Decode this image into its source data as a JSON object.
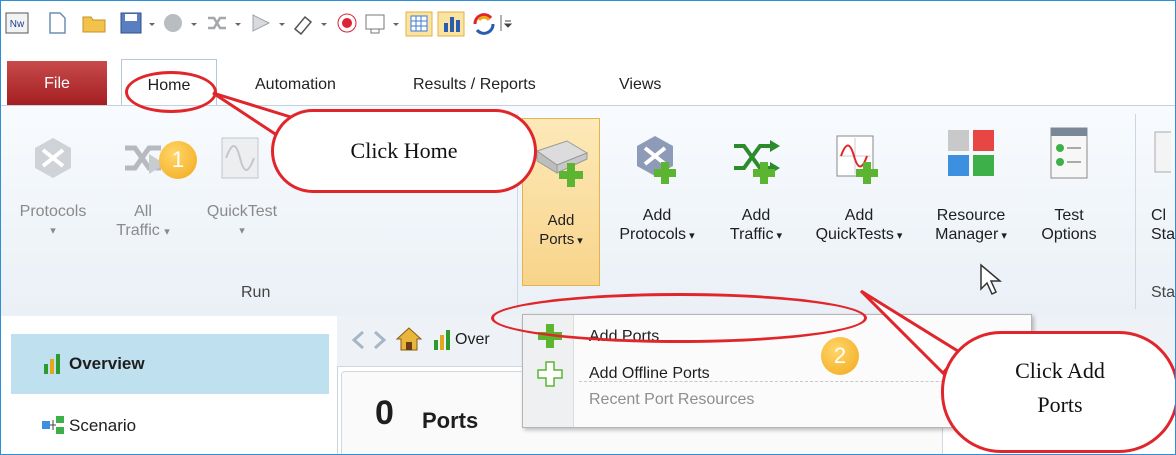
{
  "tabs": {
    "file": "File",
    "home": "Home",
    "automation": "Automation",
    "results": "Results / Reports",
    "views": "Views"
  },
  "qat": {
    "logo": "Nw"
  },
  "ribbon": {
    "run_group": {
      "label": "Run",
      "protocols": "Protocols",
      "all_traffic_line1": "All",
      "all_traffic_line2": "Traffic",
      "quicktest": "QuickTest"
    },
    "add_ports": [
      "Add",
      "Ports"
    ],
    "add_protocols": [
      "Add",
      "Protocols"
    ],
    "add_traffic": [
      "Add",
      "Traffic"
    ],
    "add_quicktests": [
      "Add",
      "QuickTests"
    ],
    "resource_manager": [
      "Resource",
      "Manager"
    ],
    "test_options": [
      "Test",
      "Options"
    ],
    "partial_button": [
      "Cl",
      "Sta"
    ],
    "partial_group": "Sta"
  },
  "dropdown": {
    "add_ports": "Add Ports",
    "add_offline_ports": "Add Offline Ports",
    "recent": "Recent Port Resources"
  },
  "nav": {
    "overview": "Overview",
    "scenario": "Scenario"
  },
  "breadcrumb": {
    "overview": "Over"
  },
  "content": {
    "ports_count": "0",
    "ports_label": "Ports"
  },
  "callouts": {
    "click_home": "Click Home",
    "click_add_ports_line1": "Click Add",
    "click_add_ports_line2": "Ports",
    "step1": "1",
    "step2": "2"
  },
  "colors": {
    "accent_red": "#e0262b",
    "badge_orange": "#f1a91a",
    "file_tab": "#a31f22",
    "selection_blue": "#bfe0ef",
    "add_green": "#5cb531"
  }
}
